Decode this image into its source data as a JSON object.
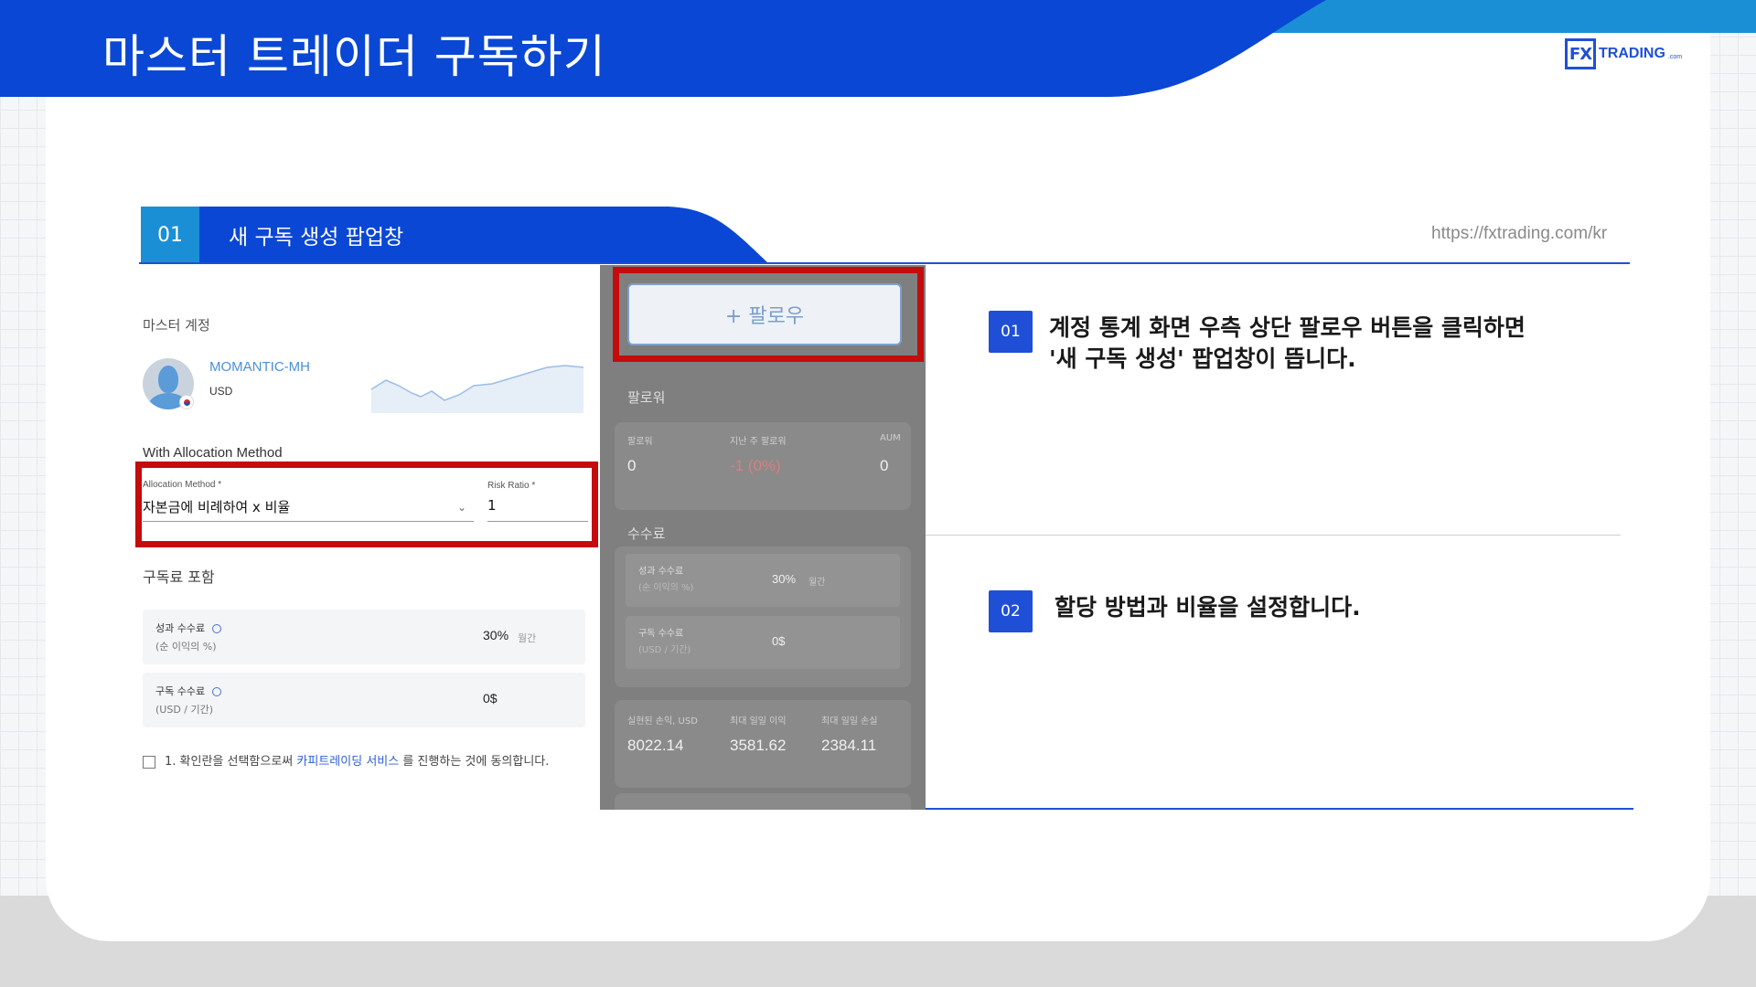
{
  "header": {
    "title": "마스터 트레이더 구독하기",
    "logo_mark": "FX",
    "logo_text": "TRADING",
    "logo_suffix": ".com",
    "brand_color": "#0a47d4"
  },
  "section": {
    "number": "01",
    "title": "새 구독 생성 팝업창",
    "url": "https://fxtrading.com/kr"
  },
  "left_panel": {
    "master_label": "마스터 계정",
    "master_name": "MOMANTIC-MH",
    "master_currency": "USD",
    "allocation_heading": "With Allocation Method",
    "allocation_method_label": "Allocation Method *",
    "allocation_method_value": "자본금에 비례하여 x 비율",
    "risk_ratio_label": "Risk Ratio *",
    "risk_ratio_value": "1",
    "fees_heading": "구독료 포함",
    "fees": [
      {
        "title": "성과 수수료",
        "sub": "(순 이익의 %)",
        "value": "30%",
        "unit": "월간"
      },
      {
        "title": "구독 수수료",
        "sub": "(USD / 기간)",
        "value": "0$",
        "unit": ""
      }
    ],
    "consent_prefix": "1. 확인란을 선택함으로써",
    "consent_link": "카피트레이딩 서비스",
    "consent_suffix": "를 진행하는 것에 동의합니다."
  },
  "middle_panel": {
    "follow_button": "+ 팔로우",
    "followers_heading": "팔로워",
    "followers_cols": [
      "팔로워",
      "지난 주 팔로워",
      "AUM"
    ],
    "followers_vals": [
      "0",
      "-1 (0%)",
      "0"
    ],
    "fees_heading": "수수료",
    "fees": [
      {
        "title": "성과 수수료",
        "sub": "(순 이익의 %)",
        "value": "30%",
        "unit": "월간"
      },
      {
        "title": "구독 수수료",
        "sub": "(USD / 기간)",
        "value": "0$",
        "unit": ""
      }
    ],
    "stats_cols": [
      "실현된 손익, USD",
      "최대 일일 이익",
      "최대 일일 손실"
    ],
    "stats_vals": [
      "8022.14",
      "3581.62",
      "2384.11"
    ]
  },
  "notes": [
    {
      "number": "01",
      "line1": "계정 통계 화면 우측 상단 팔로우 버튼을 클릭하면",
      "line2": "'새 구독 생성' 팝업창이 뜹니다."
    },
    {
      "number": "02",
      "line1": "할당 방법과 비율을 설정합니다.",
      "line2": ""
    }
  ]
}
